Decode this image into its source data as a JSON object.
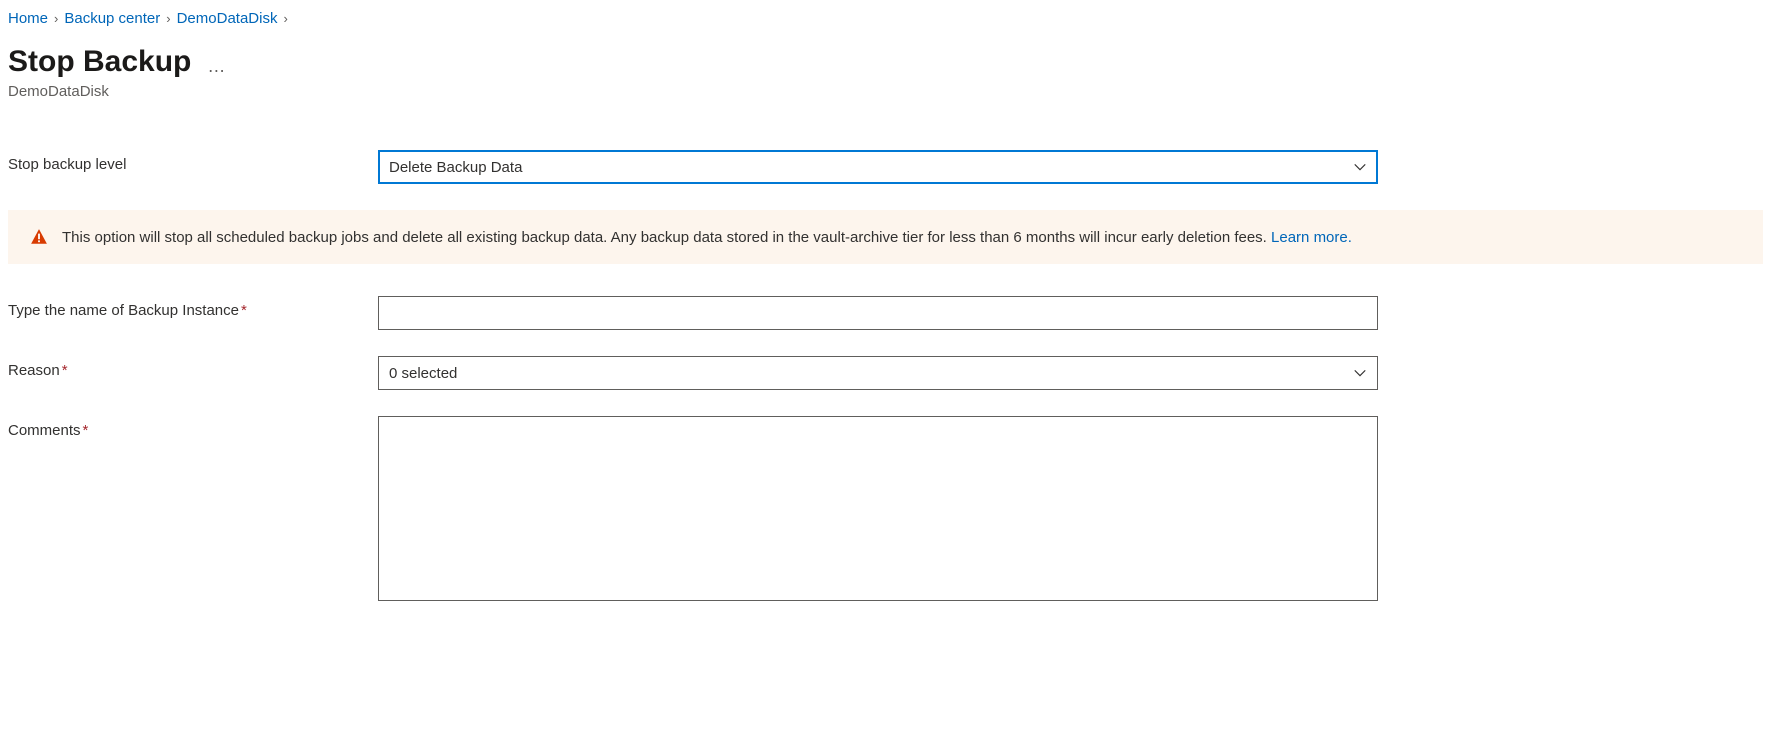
{
  "breadcrumb": {
    "home": "Home",
    "backup_center": "Backup center",
    "item": "DemoDataDisk"
  },
  "header": {
    "title": "Stop Backup",
    "subtitle": "DemoDataDisk"
  },
  "form": {
    "stop_level_label": "Stop backup level",
    "stop_level_value": "Delete Backup Data",
    "name_label": "Type the name of Backup Instance",
    "name_value": "",
    "reason_label": "Reason",
    "reason_value": "0 selected",
    "comments_label": "Comments",
    "comments_value": ""
  },
  "warning": {
    "text": "This option will stop all scheduled backup jobs and delete all existing backup data. Any backup data stored in the vault-archive tier for less than 6 months will incur early deletion fees. ",
    "link_text": "Learn more."
  }
}
